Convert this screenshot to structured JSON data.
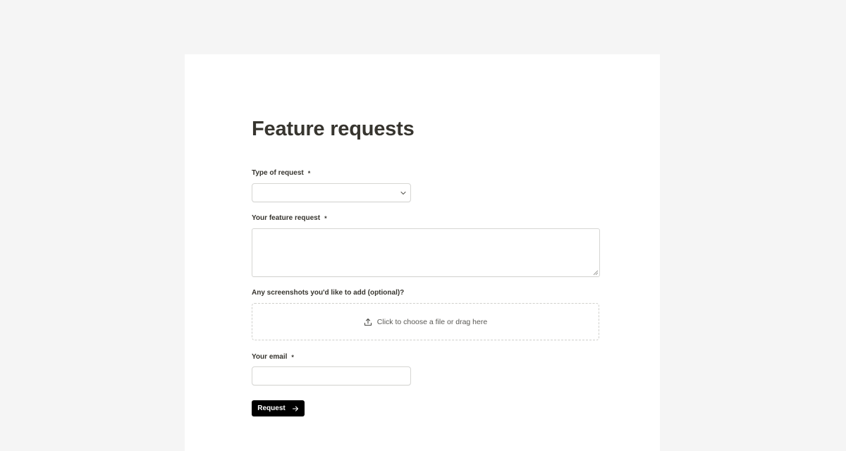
{
  "form": {
    "title": "Feature requests",
    "type_field": {
      "label": "Type of request",
      "required_mark": "*",
      "value": ""
    },
    "request_field": {
      "label": "Your feature request",
      "required_mark": "*",
      "value": ""
    },
    "screenshots_field": {
      "label": "Any screenshots you'd like to add (optional)?",
      "upload_text": "Click to choose a file or drag here",
      "icon": "upload-icon"
    },
    "email_field": {
      "label": "Your email",
      "required_mark": "*",
      "value": ""
    },
    "submit": {
      "label": "Request",
      "icon": "arrow-right-icon"
    }
  },
  "colors": {
    "page_background": "#f5f5f5",
    "card_background": "#ffffff",
    "text": "#37352f",
    "button_background": "#000000",
    "button_text": "#ffffff"
  }
}
